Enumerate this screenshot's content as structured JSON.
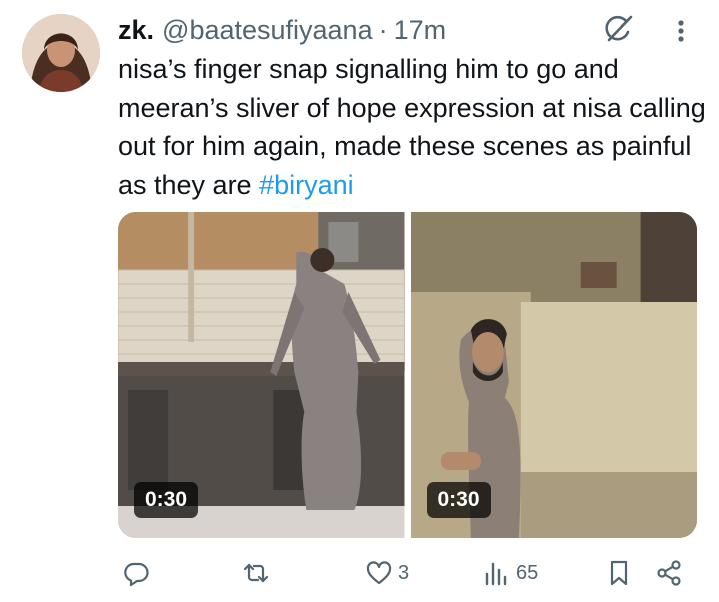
{
  "tweet": {
    "author": {
      "display_name": "zk.",
      "handle": "@baatesufiyaana",
      "separator": "·",
      "time": "17m",
      "avatar_icon": "avatar-photo"
    },
    "text_main": "nisa’s finger snap signalling him to go and meeran’s sliver of hope expression at nisa calling out for him again, made these scenes as painful as they are ",
    "hashtag": "#biryani",
    "media": [
      {
        "duration": "0:30",
        "label_icon": "video-thumbnail-kitchen"
      },
      {
        "duration": "0:30",
        "label_icon": "video-thumbnail-alley"
      }
    ],
    "actions": {
      "reply_count": "",
      "retweet_count": "",
      "like_count": "3",
      "views_count": "65"
    },
    "icons": [
      "grok-icon",
      "more-icon",
      "reply-icon",
      "retweet-icon",
      "like-icon",
      "views-icon",
      "bookmark-icon",
      "share-icon"
    ],
    "colors": {
      "accent": "#1d9bf0",
      "secondary_text": "#536471",
      "primary_text": "#0f1419"
    }
  }
}
